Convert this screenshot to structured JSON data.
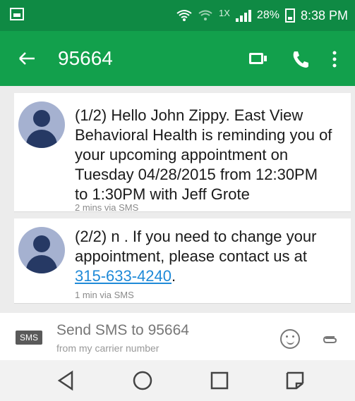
{
  "status": {
    "signal_text": "1X",
    "battery": "28%",
    "time": "8:38 PM"
  },
  "toolbar": {
    "title": "95664"
  },
  "messages": [
    {
      "text": "(1/2) Hello John Zippy. East View\nBehavioral Health is reminding you of\nyour upcoming appointment on\nTuesday 04/28/2015 from 12:30PM\nto 1:30PM with Jeff Grote",
      "meta": "2 mins via SMS"
    },
    {
      "text_before_link": "(2/2) n . If you need to change your\nappointment, please contact us at\n",
      "link": "315-633-4240",
      "text_after_link": ".",
      "meta": "1 min via SMS"
    }
  ],
  "composer": {
    "badge": "SMS",
    "placeholder_main": "Send SMS to 95664",
    "placeholder_sub": "from my carrier number"
  },
  "colors": {
    "status_bar": "#0f8a44",
    "toolbar": "#12a04c",
    "link": "#1f8ad8"
  }
}
